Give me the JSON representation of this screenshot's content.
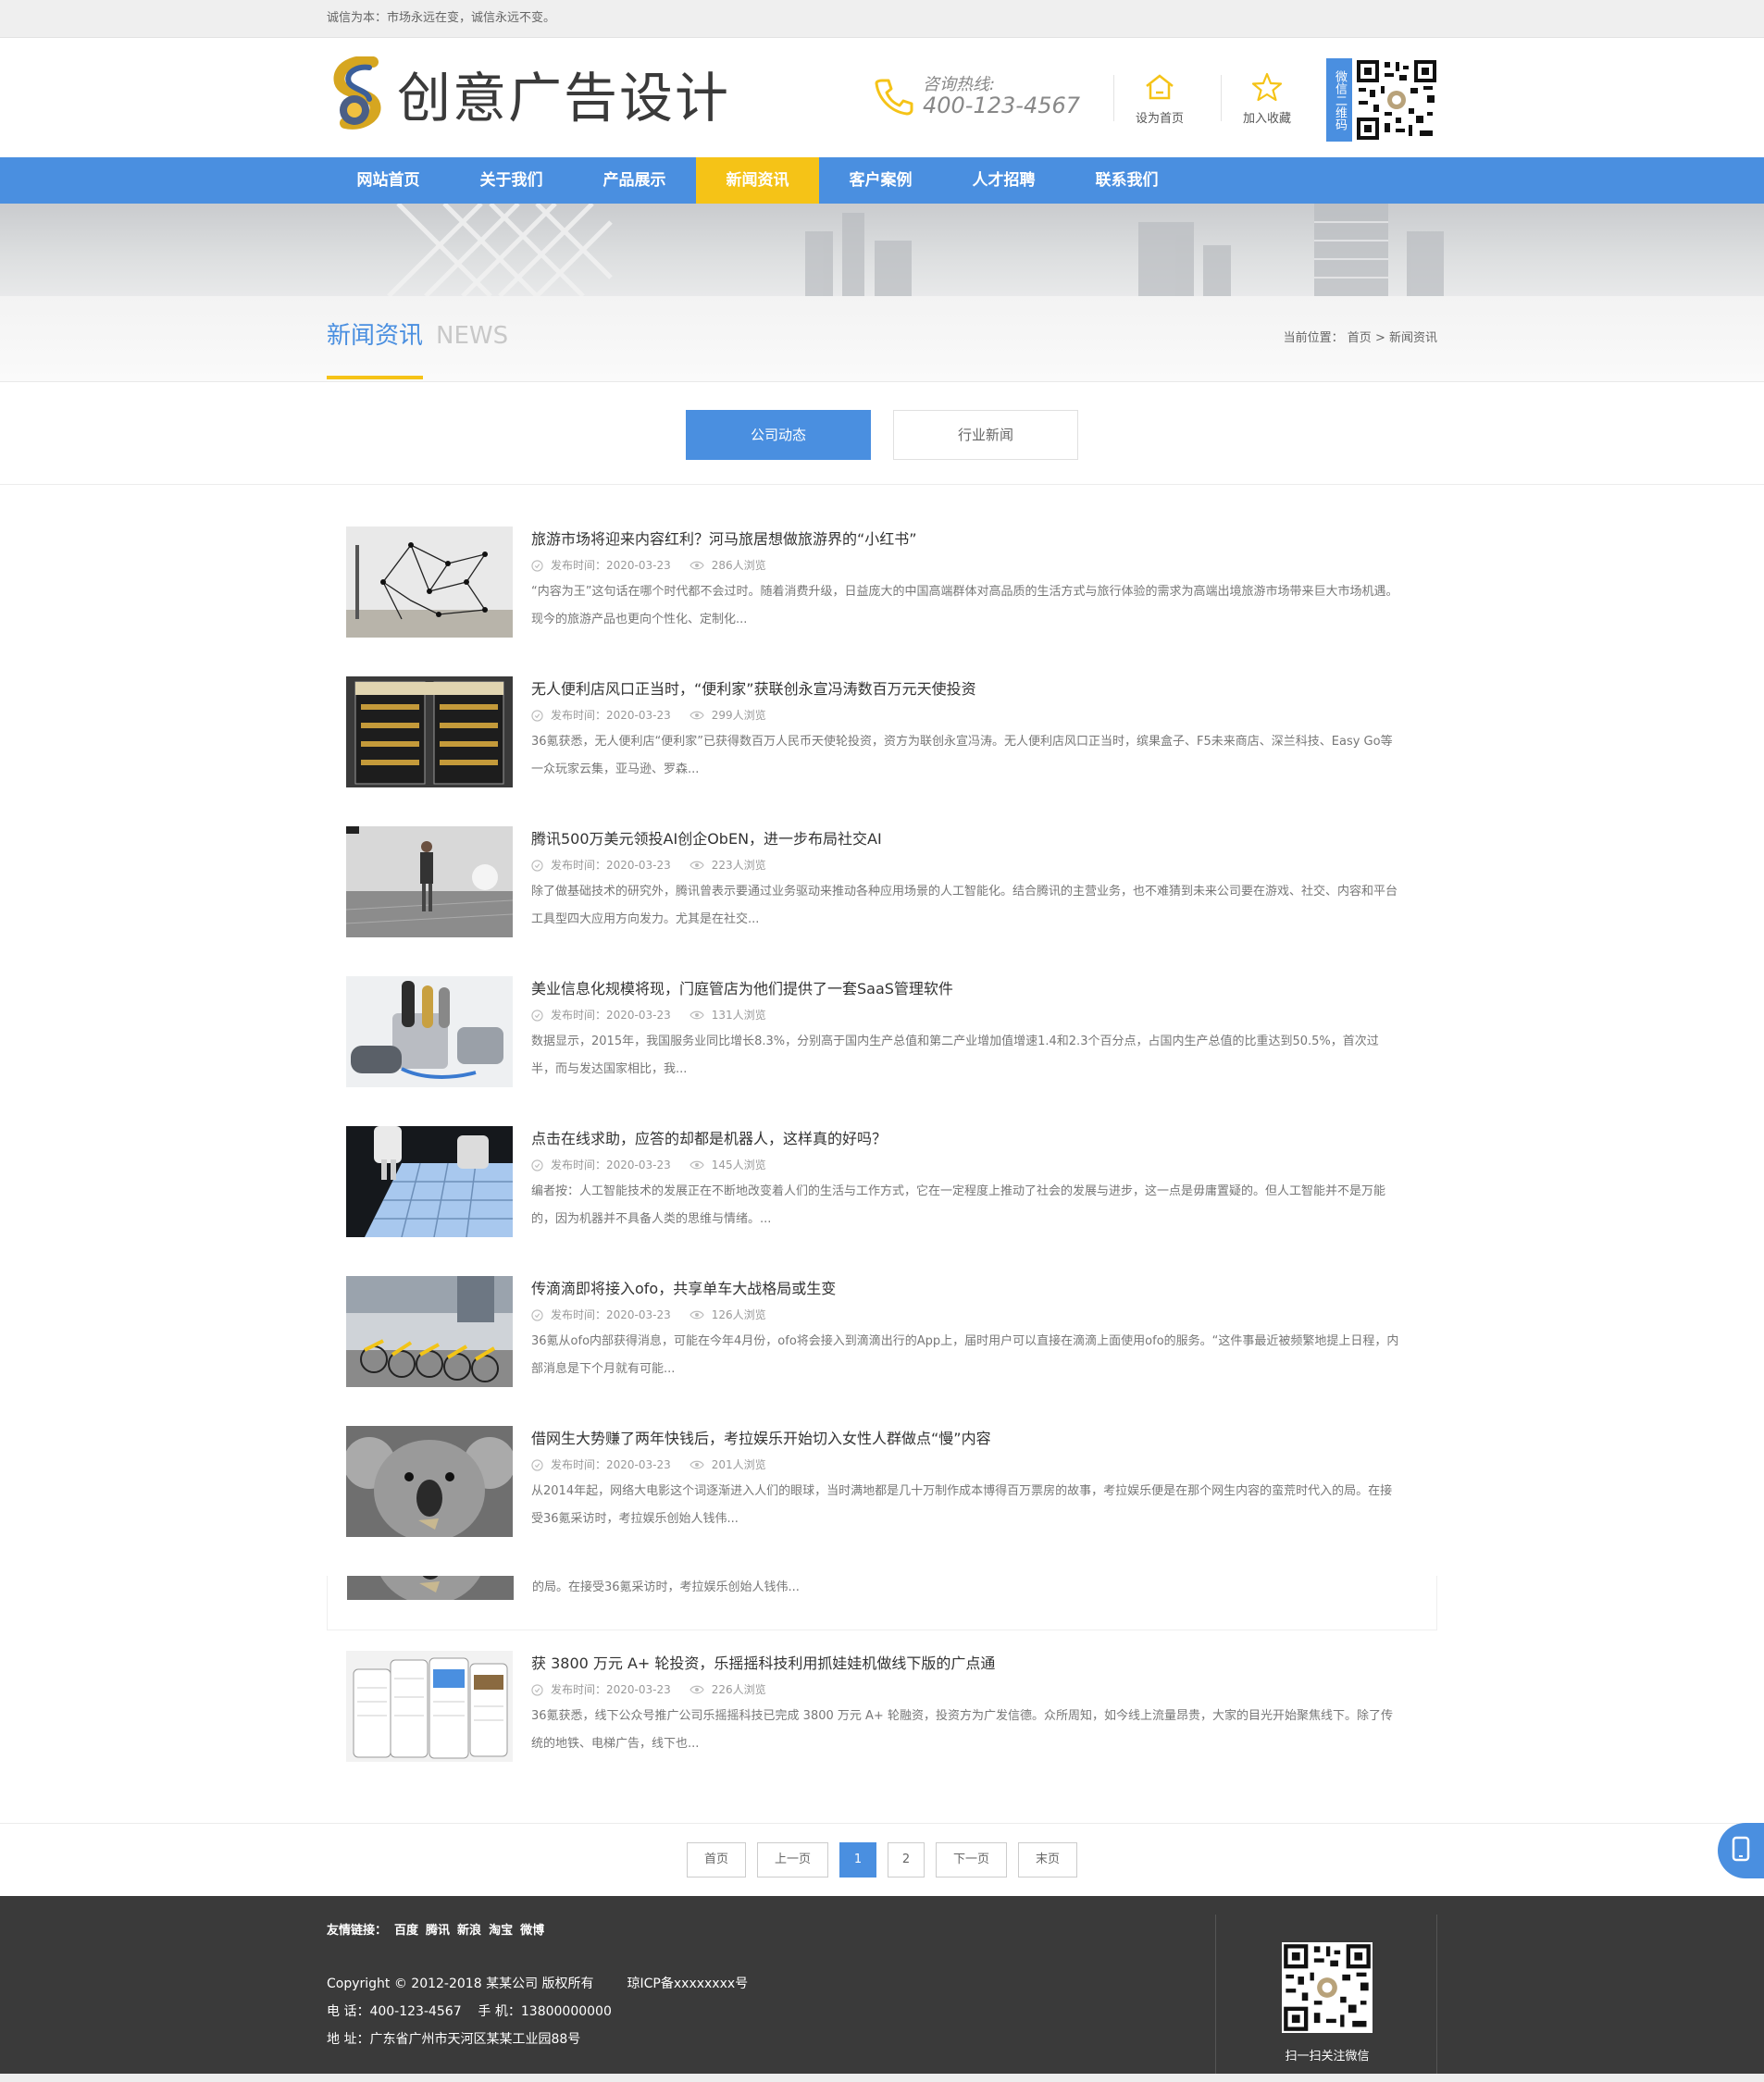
{
  "topbar": {
    "slogan": "诚信为本：市场永远在变，诚信永远不变。"
  },
  "header": {
    "logo_text": "创意广告设计",
    "hotline_label": "咨询热线:",
    "hotline_number": "400-123-4567",
    "set_home": "设为首页",
    "add_fav": "加入收藏",
    "wechat_tag": "微信二维码"
  },
  "nav": {
    "items": [
      {
        "label": "网站首页"
      },
      {
        "label": "关于我们"
      },
      {
        "label": "产品展示"
      },
      {
        "label": "新闻资讯"
      },
      {
        "label": "客户案例"
      },
      {
        "label": "人才招聘"
      },
      {
        "label": "联系我们"
      }
    ],
    "active_index": 3
  },
  "section": {
    "title_cn": "新闻资讯",
    "title_en": "NEWS",
    "breadcrumb_label": "当前位置：",
    "breadcrumb_home": "首页",
    "breadcrumb_sep": ">",
    "breadcrumb_current": "新闻资讯"
  },
  "tabs": [
    {
      "label": "公司动态",
      "active": true
    },
    {
      "label": "行业新闻",
      "active": false
    }
  ],
  "meta_date_label": "发布时间：",
  "news": [
    {
      "title": "旅游市场将迎来内容红利？河马旅居想做旅游界的“小红书”",
      "date": "2020-03-23",
      "views": "286人浏览",
      "desc": "“内容为王”这句话在哪个时代都不会过时。随着消费升级，日益庞大的中国高端群体对高品质的生活方式与旅行体验的需求为高端出境旅游市场带来巨大市场机遇。现今的旅游产品也更向个性化、定制化...",
      "thumb": "network-art"
    },
    {
      "title": "无人便利店风口正当时，“便利家”获联创永宣冯涛数百万元天使投资",
      "date": "2020-03-23",
      "views": "299人浏览",
      "desc": "36氪获悉，无人便利店“便利家”已获得数百万人民币天使轮投资，资方为联创永宣冯涛。无人便利店风口正当时，缤果盒子、F5未来商店、深兰科技、Easy Go等一众玩家云集，亚马逊、罗森...",
      "thumb": "vending-machine"
    },
    {
      "title": "腾讯500万美元领投AI创企ObEN，进一步布局社交AI",
      "date": "2020-03-23",
      "views": "223人浏览",
      "desc": "除了做基础技术的研究外，腾讯曾表示要通过业务驱动来推动各种应用场景的人工智能化。结合腾讯的主营业务，也不难猜到未来公司要在游戏、社交、内容和平台工具型四大应用方向发力。尤其是在社交...",
      "thumb": "person-street"
    },
    {
      "title": "美业信息化规模将现，门庭管店为他们提供了一套SaaS管理软件",
      "date": "2020-03-23",
      "views": "131人浏览",
      "desc": "数据显示，2015年，我国服务业同比增长8.3%，分别高于国内生产总值和第二产业增加值增速1.4和2.3个百分点，占国内生产总值的比重达到50.5%，首次过半，而与发达国家相比，我...",
      "thumb": "hair-tools"
    },
    {
      "title": "点击在线求助，应答的却都是机器人，这样真的好吗？",
      "date": "2020-03-23",
      "views": "145人浏览",
      "desc": "编者按：人工智能技术的发展正在不断地改变着人们的生活与工作方式，它在一定程度上推动了社会的发展与进步，这一点是毋庸置疑的。但人工智能并不是万能的，因为机器并不具备人类的思维与情绪。...",
      "thumb": "robot-keyboard"
    },
    {
      "title": "传滴滴即将接入ofo，共享单车大战格局或生变",
      "date": "2020-03-23",
      "views": "126人浏览",
      "desc": "36氪从ofo内部获得消息，可能在今年4月份，ofo将会接入到滴滴出行的App上，届时用户可以直接在滴滴上面使用ofo的服务。“这件事最近被频繁地提上日程，内部消息是下个月就有可能...",
      "thumb": "bikes"
    },
    {
      "title": "借网生大势赚了两年快钱后，考拉娱乐开始切入女性人群做点“慢”内容",
      "date": "2020-03-23",
      "views": "201人浏览",
      "desc": "从2014年起，网络大电影这个词逐渐进入人们的眼球，当时满地都是几十万制作成本博得百万票房的故事，考拉娱乐便是在那个网生内容的蛮荒时代入的局。在接受36氪采访时，考拉娱乐创始人钱伟...",
      "thumb": "koala"
    }
  ],
  "ghost_desc": "的局。在接受36氪采访时，考拉娱乐创始人钱伟...",
  "last_news": {
    "title": "获 3800 万元 A+ 轮投资，乐摇摇科技利用抓娃娃机做线下版的广点通",
    "date": "2020-03-23",
    "views": "226人浏览",
    "desc": "36氪获悉，线下公众号推广公司乐摇摇科技已完成 3800 万元 A+ 轮融资，投资方为广发信德。众所周知，如今线上流量昂贵，大家的目光开始聚焦线下。除了传统的地铁、电梯广告，线下也...",
    "thumb": "phones"
  },
  "pager": {
    "first": "首页",
    "prev": "上一页",
    "pages": [
      "1",
      "2"
    ],
    "current": "1",
    "next": "下一页",
    "last": "末页"
  },
  "footer": {
    "links_label": "友情链接：",
    "links": [
      "百度",
      "腾讯",
      "新浪",
      "淘宝",
      "微博"
    ],
    "copyright": "Copyright © 2012-2018 某某公司 版权所有",
    "icp": "琼ICP备xxxxxxxx号",
    "phone": "电 话：400-123-4567    手 机：13800000000",
    "address": "地 址：广东省广州市天河区某某工业园88号",
    "qr_caption": "扫一扫关注微信"
  },
  "colors": {
    "primary": "#4a8fe0",
    "accent": "#f5c317",
    "footer_bg": "#3a3a3a"
  }
}
